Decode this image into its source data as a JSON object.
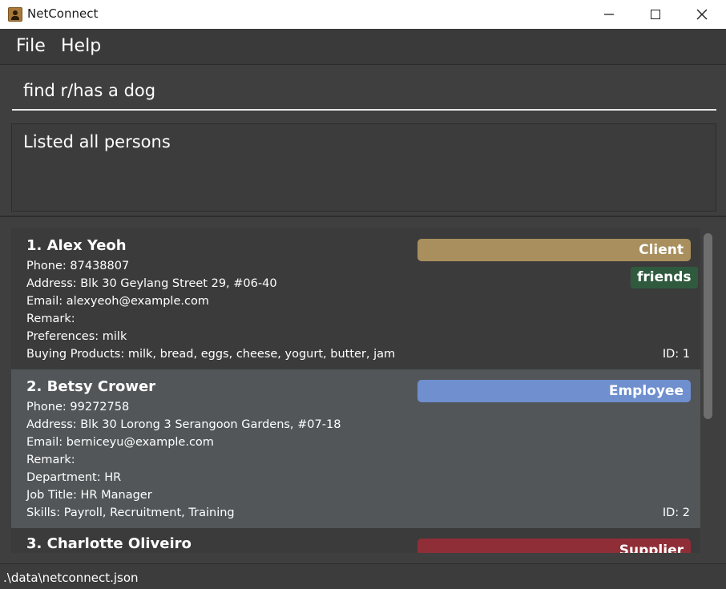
{
  "window": {
    "title": "NetConnect"
  },
  "menu": {
    "file": "File",
    "help": "Help"
  },
  "command": {
    "value": "find r/has a dog"
  },
  "result": {
    "message": "Listed all persons"
  },
  "persons": [
    {
      "header": "1.  Alex Yeoh",
      "role": "Client",
      "role_color": "#a88f5d",
      "tag": "friends",
      "fields": [
        "Phone: 87438807",
        "Address: Blk 30 Geylang Street 29, #06-40",
        "Email: alexyeoh@example.com",
        "Remark:",
        "Preferences: milk",
        "Buying Products: milk, bread, eggs, cheese, yogurt, butter, jam"
      ],
      "id": "ID: 1"
    },
    {
      "header": "2.  Betsy Crower",
      "role": "Employee",
      "role_color": "#6f8fce",
      "fields": [
        "Phone: 99272758",
        "Address: Blk 30 Lorong 3 Serangoon Gardens, #07-18",
        "Email: berniceyu@example.com",
        "Remark:",
        "Department: HR",
        "Job Title: HR Manager",
        "Skills: Payroll, Recruitment, Training"
      ],
      "id": "ID: 2"
    },
    {
      "header": "3.  Charlotte Oliveiro",
      "role": "Supplier",
      "role_color": "#8f2e37"
    }
  ],
  "status": {
    "path": ".\\data\\netconnect.json"
  }
}
